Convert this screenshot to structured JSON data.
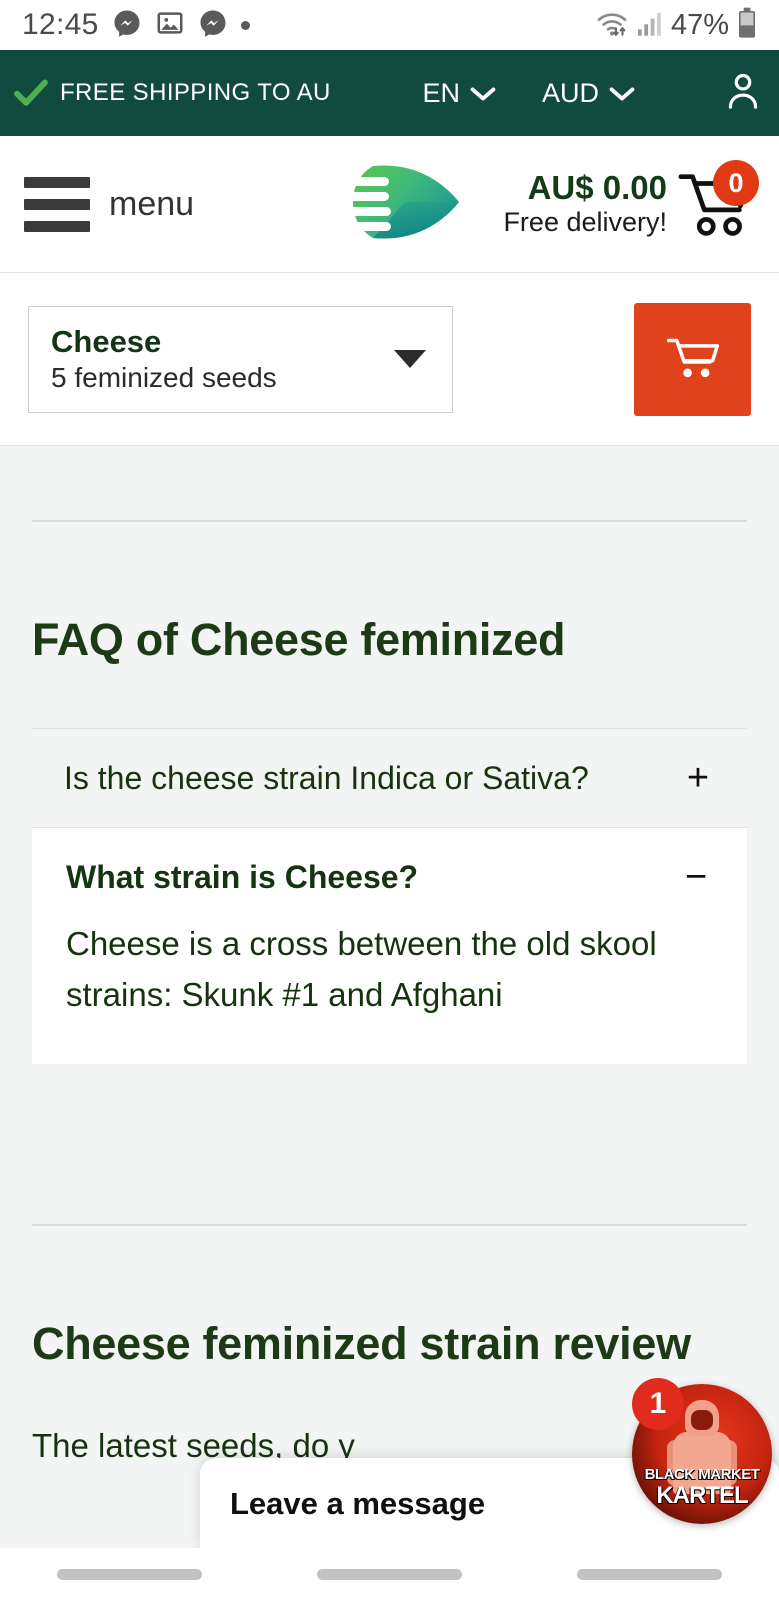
{
  "status_bar": {
    "time": "12:45",
    "battery_percent": "47%",
    "icons": [
      "messenger-icon",
      "gallery-icon",
      "messenger-icon",
      "dot-icon",
      "wifi-icon",
      "cellular-signal-icon",
      "battery-icon"
    ]
  },
  "promo_bar": {
    "check_icon": "check-icon",
    "message": "FREE SHIPPING TO AU",
    "language": "EN",
    "currency": "AUD",
    "account_icon": "user-account-icon",
    "background_color": "#114b3f"
  },
  "header": {
    "menu_label": "menu",
    "menu_icon": "hamburger-menu-icon",
    "logo_icon": "leaf-speed-logo",
    "cart_total": "AU$ 0.00",
    "cart_subtitle": "Free delivery!",
    "cart_icon": "shopping-cart-icon",
    "cart_count": "0",
    "cart_badge_color": "#e03a15"
  },
  "product_selector": {
    "variant_name": "Cheese",
    "variant_quantity": "5  feminized seeds",
    "caret_icon": "caret-down-icon",
    "add_to_cart_icon": "shopping-cart-icon",
    "add_to_cart_color": "#e0431c"
  },
  "faq_section": {
    "title": "FAQ of Cheese feminized",
    "items": [
      {
        "question": "Is the cheese strain Indica or Sativa?",
        "toggle": "+",
        "expanded": false,
        "answer": ""
      },
      {
        "question": "What strain is Cheese?",
        "toggle": "−",
        "expanded": true,
        "answer": "Cheese is a cross between the old skool strains: Skunk #1 and Afghani"
      }
    ]
  },
  "review_section": {
    "title": "Cheese feminized strain review",
    "paragraph": "The latest                 \nseeds, do y"
  },
  "chat_widget": {
    "title": "Leave a message",
    "unread_count": "1",
    "avatar_name": "black-market-kartel-avatar",
    "avatar_brand_line1": "BLACK MARKET",
    "avatar_brand_line2": "KARTEL"
  },
  "nav_bar": {
    "pills": [
      "recents-pill",
      "home-pill",
      "back-pill"
    ]
  }
}
